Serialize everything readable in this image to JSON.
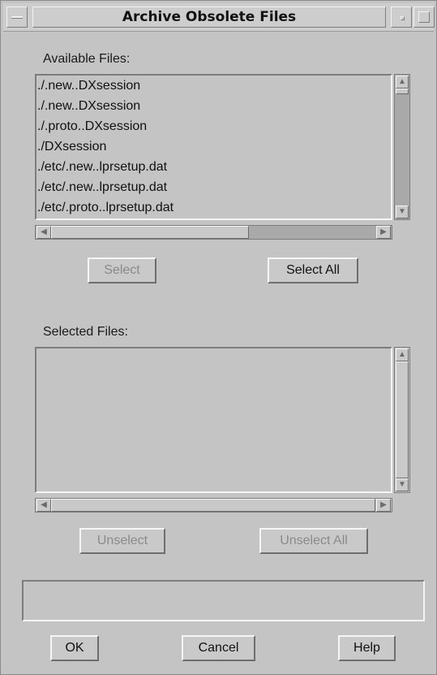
{
  "window": {
    "title": "Archive Obsolete Files"
  },
  "available": {
    "label": "Available Files:",
    "files": [
      "./.new..DXsession",
      "./.new..DXsession",
      "./.proto..DXsession",
      "./DXsession",
      "./etc/.new..lprsetup.dat",
      "./etc/.new..lprsetup.dat",
      "./etc/.proto..lprsetup.dat"
    ],
    "select_label": "Select",
    "select_all_label": "Select All"
  },
  "selected": {
    "label": "Selected Files:",
    "files": [],
    "unselect_label": "Unselect",
    "unselect_all_label": "Unselect All"
  },
  "status": {
    "text": ""
  },
  "footer": {
    "ok_label": "OK",
    "cancel_label": "Cancel",
    "help_label": "Help"
  },
  "icons": {
    "up": "scroll-up-arrow",
    "down": "scroll-down-arrow",
    "left": "scroll-left-arrow",
    "right": "scroll-right-arrow"
  }
}
